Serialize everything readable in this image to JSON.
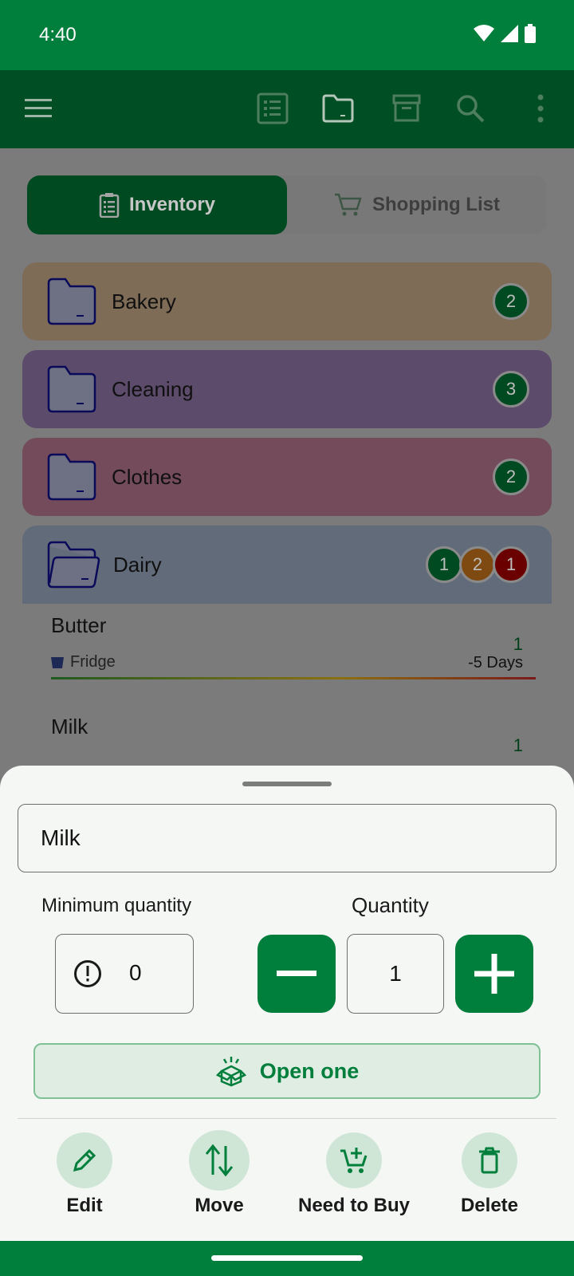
{
  "status": {
    "time": "4:40"
  },
  "tabs": {
    "inventory": "Inventory",
    "shopping": "Shopping List"
  },
  "folders": [
    {
      "name": "Bakery",
      "color": "#7e6c57",
      "badges": [
        "2"
      ]
    },
    {
      "name": "Cleaning",
      "color": "#5d4b6b",
      "badges": [
        "3"
      ]
    },
    {
      "name": "Clothes",
      "color": "#744b5a",
      "badges": [
        "2"
      ]
    },
    {
      "name": "Dairy",
      "color": "#626b79",
      "badges": [
        "1",
        "2",
        "1"
      ]
    }
  ],
  "items": [
    {
      "name": "Butter",
      "location": "Fridge",
      "quantity": "1",
      "days": "-5 Days"
    },
    {
      "name": "Milk",
      "quantity": "1"
    }
  ],
  "sheet": {
    "name_value": "Milk",
    "min_label": "Minimum quantity",
    "min_value": "0",
    "qty_label": "Quantity",
    "qty_value": "1",
    "open_label": "Open one",
    "actions": {
      "edit": "Edit",
      "move": "Move",
      "need": "Need to Buy",
      "delete": "Delete"
    }
  },
  "colors": {
    "primary": "#007e3b",
    "dark": "#004e24"
  }
}
